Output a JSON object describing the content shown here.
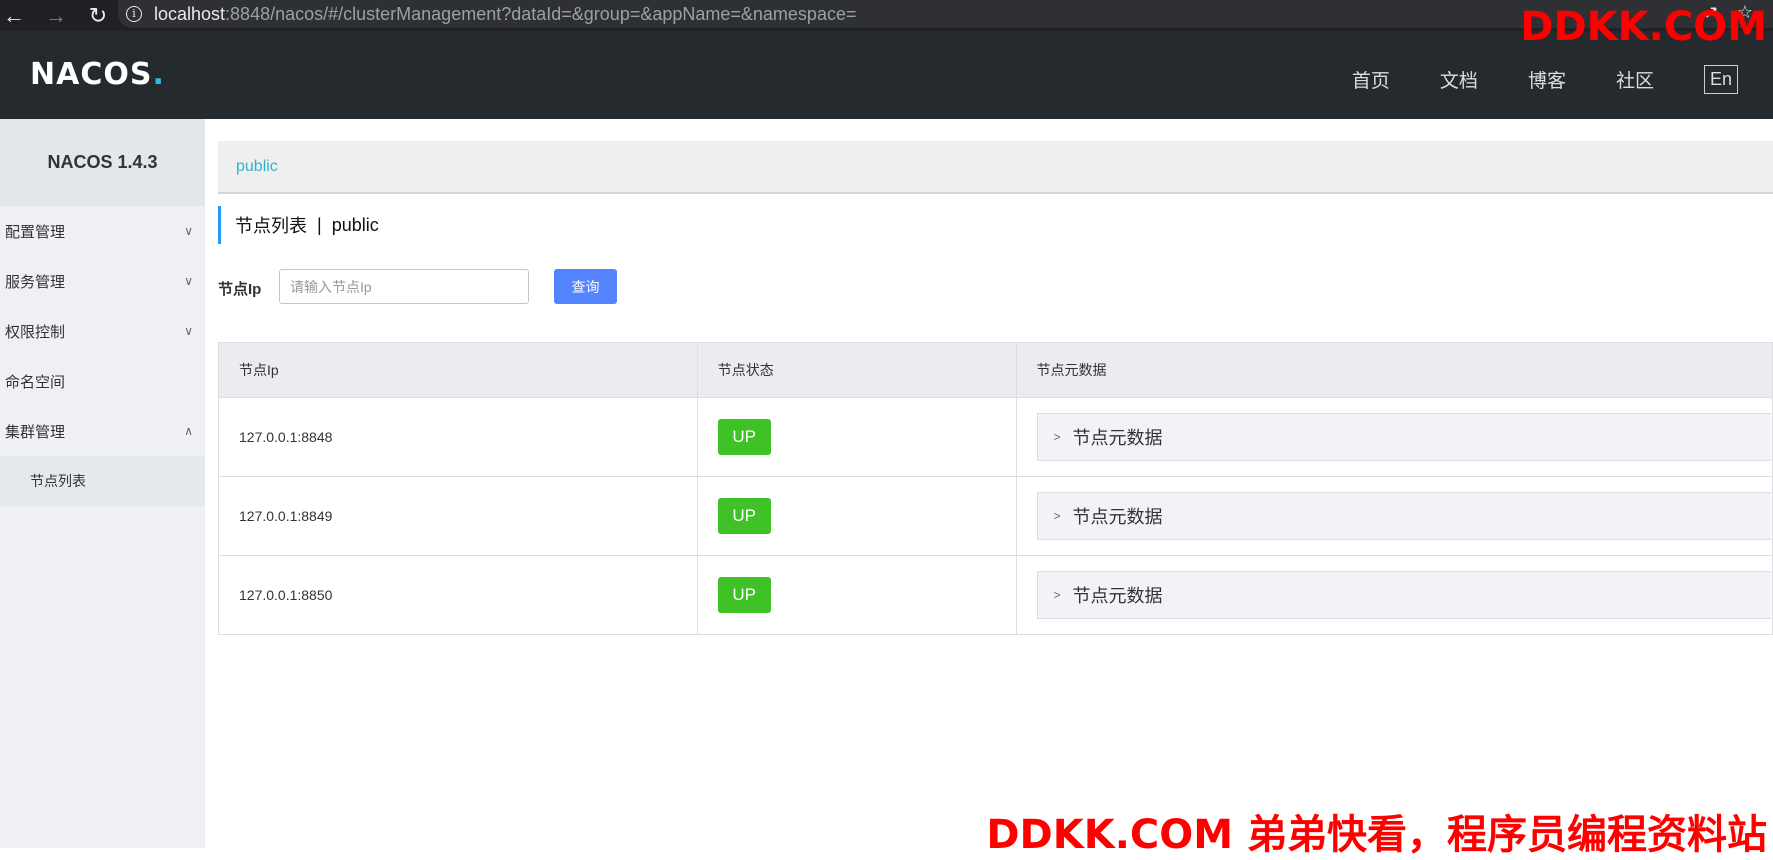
{
  "browser": {
    "back_icon": "arrow-left-icon",
    "forward_icon": "arrow-right-icon",
    "reload_icon": "reload-icon",
    "url_host": "localhost",
    "url_rest": ":8848/nacos/#/clusterManagement?dataId=&group=&appName=&namespace="
  },
  "header": {
    "logo_text": "NACOS",
    "logo_dot": ".",
    "nav": [
      "首页",
      "文档",
      "博客",
      "社区"
    ],
    "lang_label": "En"
  },
  "sidebar": {
    "product": "NACOS 1.4.3",
    "items": [
      {
        "label": "配置管理",
        "expanded": false
      },
      {
        "label": "服务管理",
        "expanded": false
      },
      {
        "label": "权限控制",
        "expanded": false
      },
      {
        "label": "命名空间"
      },
      {
        "label": "集群管理",
        "expanded": true
      }
    ],
    "submenu": [
      "节点列表"
    ]
  },
  "breadcrumb": {
    "namespace": "public"
  },
  "page": {
    "title": "节点列表",
    "separator": "|",
    "namespace": "public"
  },
  "search": {
    "label": "节点Ip",
    "placeholder": "请输入节点Ip",
    "value": "",
    "button": "查询"
  },
  "table": {
    "headers": [
      "节点Ip",
      "节点状态",
      "节点元数据"
    ],
    "rows": [
      {
        "ip": "127.0.0.1:8848",
        "status": "UP",
        "meta": "节点元数据"
      },
      {
        "ip": "127.0.0.1:8849",
        "status": "UP",
        "meta": "节点元数据"
      },
      {
        "ip": "127.0.0.1:8850",
        "status": "UP",
        "meta": "节点元数据"
      }
    ]
  },
  "colors": {
    "header_bg": "#252a2f",
    "accent": "#5584ff",
    "status_up": "#3fc225",
    "watermark": "#ff0000"
  },
  "watermark": {
    "top": "DDKK.COM",
    "bottom": "DDKK.COM 弟弟快看，程序员编程资料站"
  }
}
